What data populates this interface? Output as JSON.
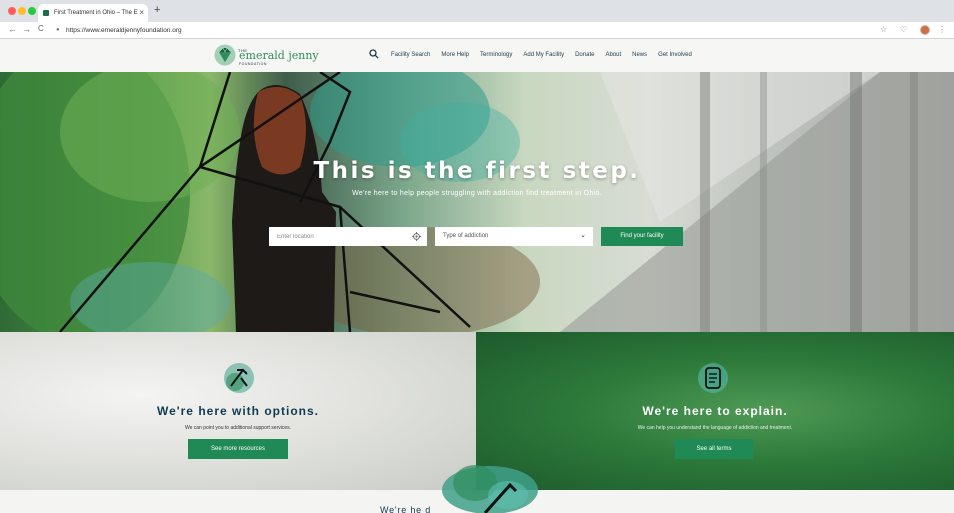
{
  "browser": {
    "tab_title": "First Treatment in Ohio – The E",
    "tab_close": "×",
    "new_tab": "+",
    "url": "https://www.emeraldjennyfoundation.org",
    "nav_back": "←",
    "nav_forward": "→",
    "nav_reload": "C",
    "bookmark_icon": "☆",
    "extension_icon": "♡",
    "menu_icon": "⋮"
  },
  "site": {
    "logo": {
      "top": "THE",
      "name": "emerald jenny",
      "bottom": "FOUNDATION"
    },
    "nav": [
      "Facility Search",
      "More Help",
      "Terminology",
      "Add My Facility",
      "Donate",
      "About",
      "News",
      "Get Involved"
    ]
  },
  "hero": {
    "title": "This is the first step.",
    "subtitle": "We're here to help people struggling with addiction find treatment in Ohio.",
    "location_placeholder": "Enter location",
    "addiction_placeholder": "Type of addiction",
    "find_button": "Find your facility"
  },
  "panels": {
    "left": {
      "title": "We're here with options.",
      "subtitle": "We can point you to additional support services.",
      "button": "See more resources",
      "icon": "signpost-icon"
    },
    "right": {
      "title": "We're here to explain.",
      "subtitle": "We can help you understand the language of addiction and treatment.",
      "button": "See all terms",
      "icon": "document-icon"
    }
  },
  "bottom": {
    "peek_text": "We're he                     d"
  },
  "colors": {
    "brand_green": "#1f8a55",
    "navy": "#123a52",
    "logo_green": "#2f8d5d"
  }
}
